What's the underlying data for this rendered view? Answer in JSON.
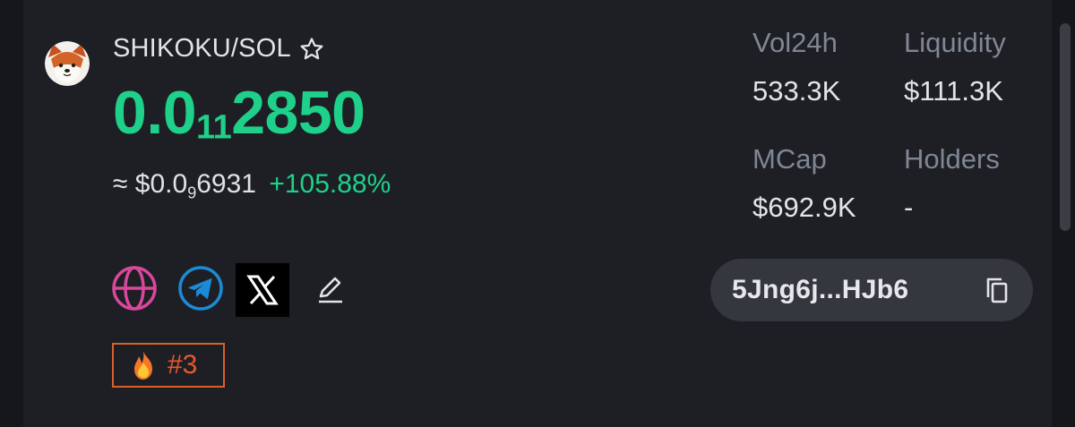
{
  "token": {
    "pair": "SHIKOKU/SOL",
    "price_prefix": "0.0",
    "price_zero_count": "11",
    "price_digits": "2850",
    "usd_prefix": "≈ $0.0",
    "usd_zero_count": "9",
    "usd_digits": "6931",
    "change": "+105.88%"
  },
  "stats": {
    "vol_label": "Vol24h",
    "vol_value": "533.3K",
    "liq_label": "Liquidity",
    "liq_value": "$111.3K",
    "mcap_label": "MCap",
    "mcap_value": "$692.9K",
    "holders_label": "Holders",
    "holders_value": "-"
  },
  "address": {
    "short": "5Jng6j...HJb6"
  },
  "rank": {
    "label": "#3"
  },
  "icons": {
    "avatar": "shiba-avatar-icon",
    "favorite": "star-outline-icon",
    "website": "globe-icon",
    "telegram": "telegram-icon",
    "x": "x-logo-icon",
    "edit": "pencil-icon",
    "rank": "fire-icon",
    "copy": "copy-icon"
  },
  "colors": {
    "background": "#1d1f24",
    "price_green": "#1fd08a",
    "label_gray": "#7f8694",
    "globe_pink": "#d9479b",
    "telegram_blue": "#1c8ad6",
    "rank_orange": "#e8582d"
  }
}
